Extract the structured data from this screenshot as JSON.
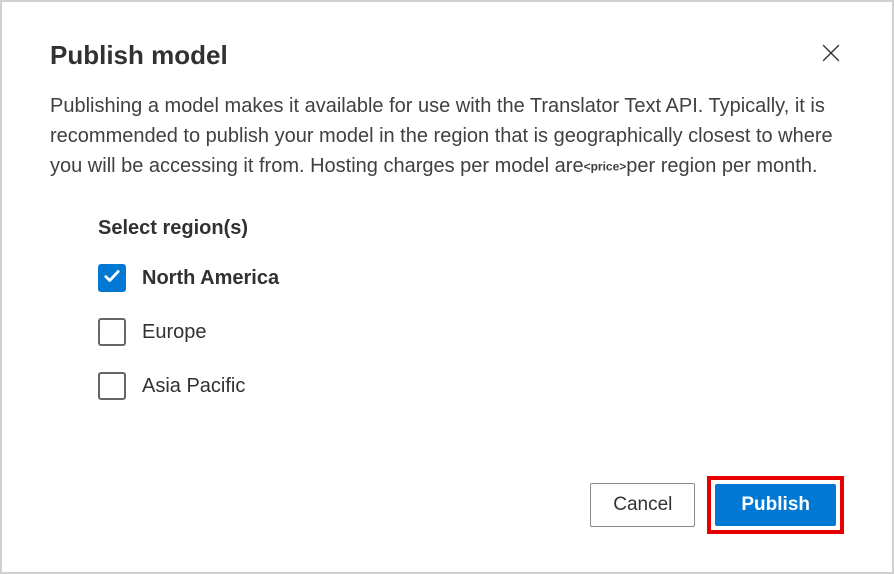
{
  "dialog": {
    "title": "Publish model",
    "description_pre": "Publishing a model makes it available for use with the Translator Text API. Typically, it is recommended to publish your model in the region that is geographically closest to where you will be accessing it from. Hosting charges per model are",
    "price_placeholder": "<price>",
    "description_post": "per region per month."
  },
  "regions": {
    "label": "Select region(s)",
    "options": [
      {
        "label": "North America",
        "checked": true
      },
      {
        "label": "Europe",
        "checked": false
      },
      {
        "label": "Asia Pacific",
        "checked": false
      }
    ]
  },
  "actions": {
    "cancel": "Cancel",
    "publish": "Publish"
  }
}
